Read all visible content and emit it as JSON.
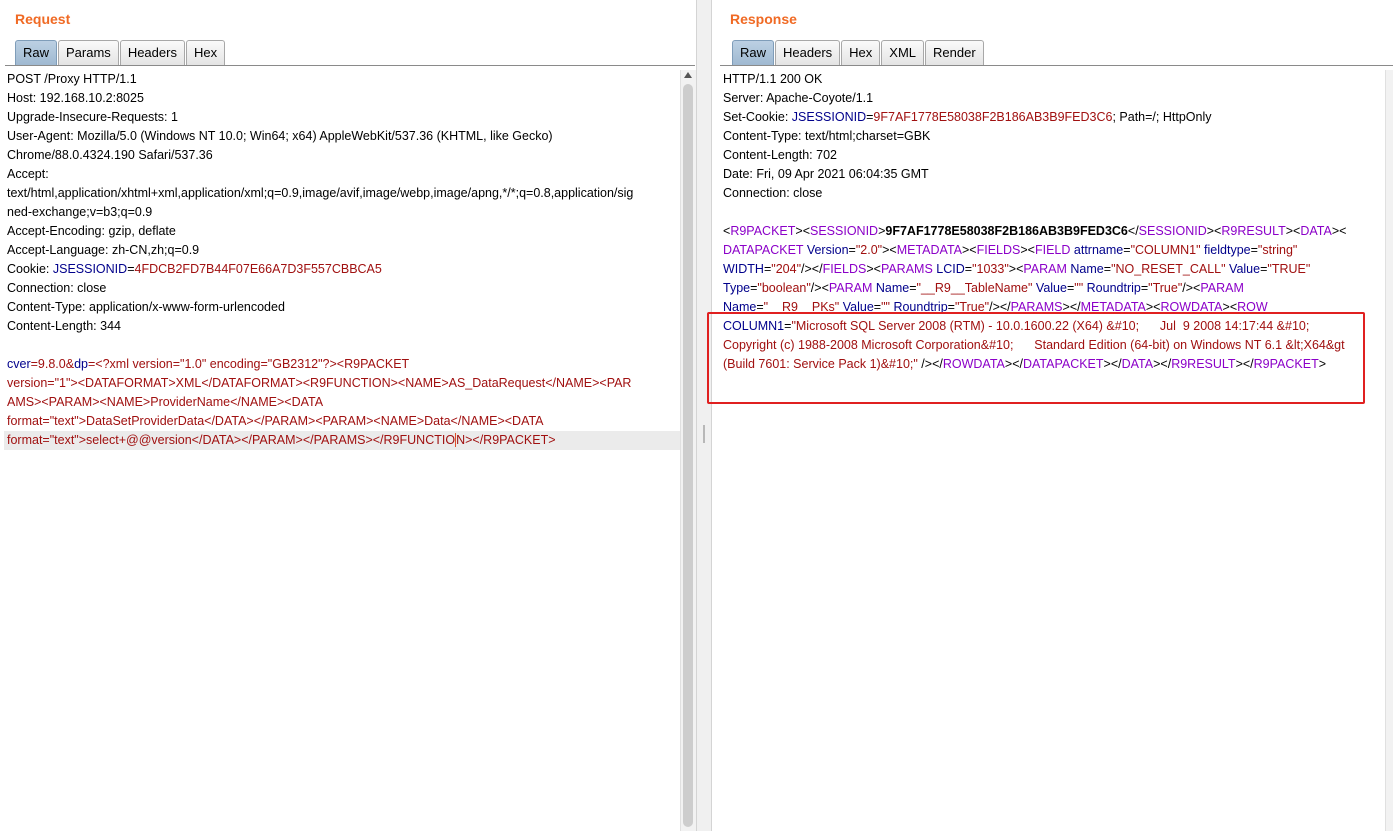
{
  "request": {
    "title": "Request",
    "tabs": [
      "Raw",
      "Params",
      "Headers",
      "Hex"
    ],
    "active_tab": "Raw"
  },
  "response": {
    "title": "Response",
    "tabs": [
      "Raw",
      "Headers",
      "Hex",
      "XML",
      "Render"
    ],
    "active_tab": "Raw"
  },
  "highlight_box_color": "#e02020",
  "title_color": "#f06a24"
}
